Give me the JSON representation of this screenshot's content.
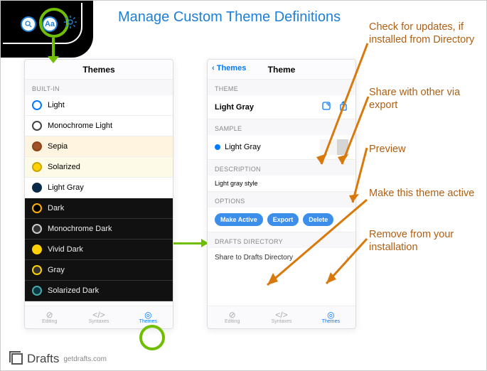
{
  "title": "Manage Custom Theme Definitions",
  "annotations": {
    "updates": "Check for updates, if installed from Directory",
    "share": "Share with other via export",
    "preview": "Preview",
    "make_active": "Make this theme active",
    "remove": "Remove from your installation"
  },
  "left_phone": {
    "header": "Themes",
    "section_builtin": "BUILT-IN",
    "themes": [
      {
        "name": "Light",
        "swatch_border": "#007aff",
        "swatch_bg": "#fff",
        "row_class": ""
      },
      {
        "name": "Monochrome Light",
        "swatch_border": "#444",
        "swatch_bg": "#fff",
        "row_class": ""
      },
      {
        "name": "Sepia",
        "swatch_border": "#8b4513",
        "swatch_bg": "#a0522d",
        "row_class": "row-sepia"
      },
      {
        "name": "Solarized",
        "swatch_border": "#c9a500",
        "swatch_bg": "#ffd300",
        "row_class": "row-solarized"
      },
      {
        "name": "Light Gray",
        "swatch_border": "#0a2a4a",
        "swatch_bg": "#0a2a4a",
        "row_class": ""
      },
      {
        "name": "Dark",
        "swatch_border": "#ffb000",
        "swatch_bg": "#000",
        "row_class": "dark-row"
      },
      {
        "name": "Monochrome Dark",
        "swatch_border": "#ccc",
        "swatch_bg": "#333",
        "row_class": "dark-row"
      },
      {
        "name": "Vivid Dark",
        "swatch_border": "#ffd000",
        "swatch_bg": "#ffd000",
        "row_class": "dark-row"
      },
      {
        "name": "Gray",
        "swatch_border": "#ffd000",
        "swatch_bg": "#333",
        "row_class": "dark-row"
      },
      {
        "name": "Solarized Dark",
        "swatch_border": "#4aa",
        "swatch_bg": "#0b3642",
        "row_class": "dark-row"
      }
    ],
    "footer": {
      "editing": "Editing",
      "syntaxes": "Syntaxes",
      "themes": "Themes"
    }
  },
  "right_phone": {
    "back": "Themes",
    "header": "Theme",
    "section_theme": "THEME",
    "theme_name": "Light Gray",
    "section_sample": "SAMPLE",
    "sample_name": "Light Gray",
    "section_desc": "DESCRIPTION",
    "desc_text": "Light gray style",
    "section_options": "OPTIONS",
    "btn_make_active": "Make Active",
    "btn_export": "Export",
    "btn_delete": "Delete",
    "section_directory": "DRAFTS DIRECTORY",
    "share_directory": "Share to Drafts Directory",
    "footer": {
      "editing": "Editing",
      "syntaxes": "Syntaxes",
      "themes": "Themes"
    }
  },
  "brand": {
    "name": "Drafts",
    "url": "getdrafts.com"
  }
}
